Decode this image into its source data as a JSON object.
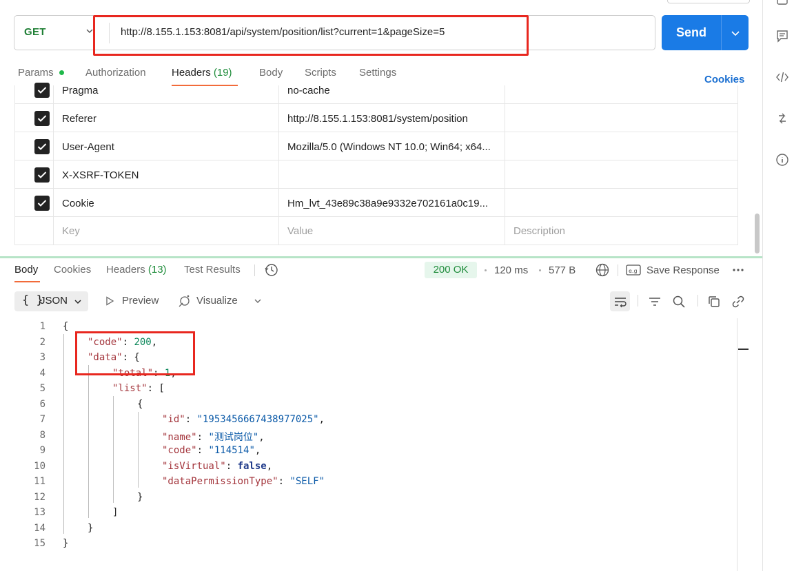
{
  "request": {
    "method": "GET",
    "url": "http://8.155.1.153:8081/api/system/position/list?current=1&pageSize=5",
    "send_label": "Send"
  },
  "request_tabs": {
    "params": "Params",
    "authorization": "Authorization",
    "headers": "Headers",
    "headers_count": "(19)",
    "body": "Body",
    "scripts": "Scripts",
    "settings": "Settings",
    "cookies": "Cookies"
  },
  "headers_table": {
    "rows": [
      {
        "key": "Pragma",
        "value": "no-cache",
        "checked": true
      },
      {
        "key": "Referer",
        "value": "http://8.155.1.153:8081/system/position",
        "checked": true
      },
      {
        "key": "User-Agent",
        "value": "Mozilla/5.0 (Windows NT 10.0; Win64; x64...",
        "checked": true
      },
      {
        "key": "X-XSRF-TOKEN",
        "value": "",
        "checked": true
      },
      {
        "key": "Cookie",
        "value": "Hm_lvt_43e89c38a9e9332e702161a0c19...",
        "checked": true
      }
    ],
    "placeholder": {
      "key": "Key",
      "value": "Value",
      "description": "Description"
    }
  },
  "response_tabs": {
    "body": "Body",
    "cookies": "Cookies",
    "headers": "Headers",
    "headers_count": "(13)",
    "test_results": "Test Results"
  },
  "response_meta": {
    "status": "200 OK",
    "time": "120 ms",
    "size": "577 B",
    "save_response": "Save Response"
  },
  "response_toolbar": {
    "format": "JSON",
    "preview": "Preview",
    "visualize": "Visualize"
  },
  "code_lines": [
    "1",
    "2",
    "3",
    "4",
    "5",
    "6",
    "7",
    "8",
    "9",
    "10",
    "11",
    "12",
    "13",
    "14",
    "15"
  ],
  "json_body": {
    "code_key": "\"code\"",
    "code_val": "200",
    "data_key": "\"data\"",
    "total_key": "\"total\"",
    "total_val": "1",
    "list_key": "\"list\"",
    "id_key": "\"id\"",
    "id_val": "\"1953456667438977025\"",
    "name_key": "\"name\"",
    "name_val": "\"测试岗位\"",
    "code2_key": "\"code\"",
    "code2_val": "\"114514\"",
    "isvirtual_key": "\"isVirtual\"",
    "isvirtual_val": "false",
    "dpt_key": "\"dataPermissionType\"",
    "dpt_val": "\"SELF\""
  },
  "colors": {
    "send": "#1a7be6",
    "status_ok": "#1f8c3b",
    "active_tab": "#f26b3a",
    "highlight": "#e8271f"
  }
}
